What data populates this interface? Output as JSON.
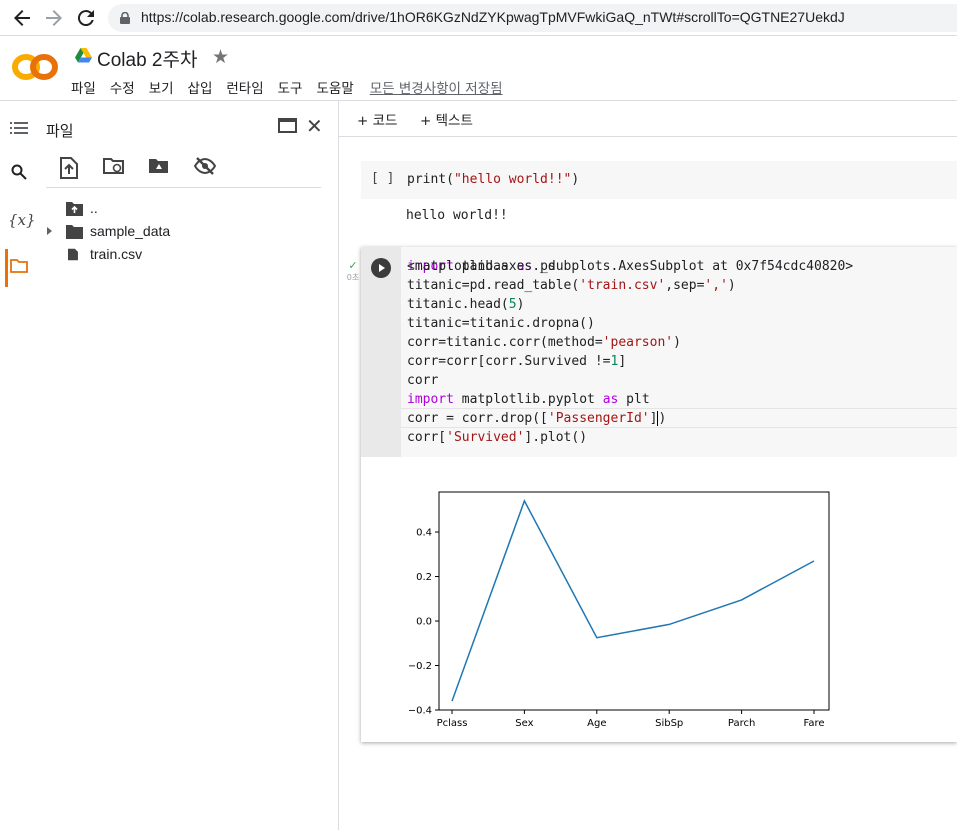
{
  "browser": {
    "url": "https://colab.research.google.com/drive/1hOR6KGzNdZYKpwagTpMVFwkiGaQ_nTWt#scrollTo=QGTNE27UekdJ"
  },
  "header": {
    "logo": "CO",
    "title": "Colab 2주차",
    "menu": [
      "파일",
      "수정",
      "보기",
      "삽입",
      "런타임",
      "도구",
      "도움말"
    ],
    "saved_status": "모든 변경사항이 저장됨"
  },
  "sidebar": {
    "title": "파일",
    "tree": [
      {
        "label": ".."
      },
      {
        "label": "sample_data"
      },
      {
        "label": "train.csv"
      }
    ],
    "rail_icons": [
      "toc-icon",
      "search-icon",
      "variables-icon",
      "folder-icon"
    ],
    "variables_label": "{x}"
  },
  "toolbar": {
    "add_code": "+ 코드",
    "add_text": "+ 텍스트"
  },
  "cells": {
    "cell1": {
      "bracket": "[ ]",
      "output": "hello world!!"
    },
    "cell2": {
      "exec_time": "0초",
      "output": "<matplotlib.axes._subplots.AxesSubplot at 0x7f54cdc40820>"
    }
  },
  "chart_data": {
    "type": "line",
    "categories": [
      "Pclass",
      "Sex",
      "Age",
      "SibSp",
      "Parch",
      "Fare"
    ],
    "values": [
      -0.36,
      0.54,
      -0.075,
      -0.015,
      0.095,
      0.27
    ],
    "ylim": [
      -0.4,
      0.58
    ],
    "yticks": [
      "0.4",
      "0.2",
      "0.0",
      "−0.2",
      "−0.4"
    ],
    "ytick_values": [
      0.4,
      0.2,
      0.0,
      -0.2,
      -0.4
    ],
    "line_color": "#1f77b4",
    "grid": false
  }
}
